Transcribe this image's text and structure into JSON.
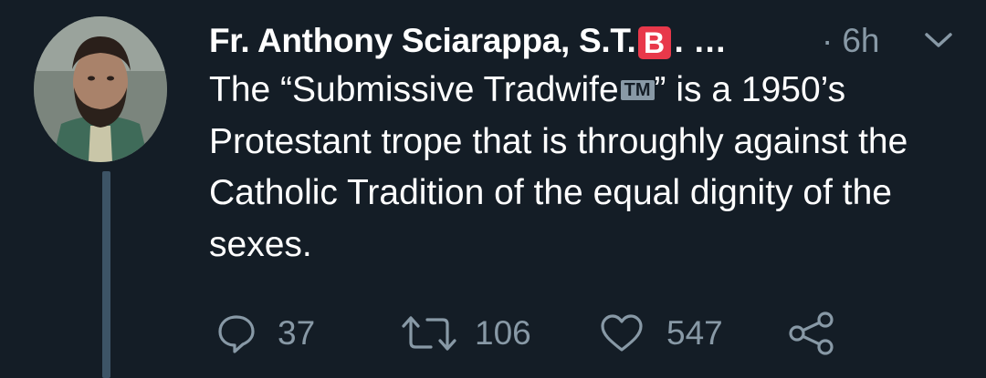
{
  "tweet": {
    "author_name": "Fr. Anthony Sciarappa, S.T.",
    "author_badge": "B",
    "author_truncation": ". …",
    "separator": "·",
    "time": "6h",
    "text_before_tm": "The “Submissive Tradwife",
    "tm_mark": "TM",
    "text_after_tm": "” is a 1950’s Protestant trope that is throughly against the Catholic Tradition of the equal dignity of the sexes."
  },
  "actions": {
    "reply_count": "37",
    "retweet_count": "106",
    "like_count": "547"
  },
  "icons": {
    "reply": "reply-icon",
    "retweet": "retweet-icon",
    "like": "heart-icon",
    "share": "share-icon",
    "menu": "chevron-down-icon"
  },
  "colors": {
    "background": "#141d26",
    "text": "#ffffff",
    "muted": "#8899a6",
    "badge": "#e8384a",
    "thread_line": "#3d5466"
  }
}
